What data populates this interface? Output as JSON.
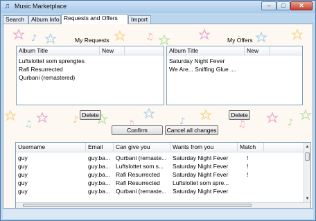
{
  "window": {
    "title": "Music Marketplace",
    "minimize_glyph": "–",
    "maximize_glyph": "□",
    "close_glyph": "✕",
    "icon": "music-note-icon"
  },
  "tabs": [
    {
      "label": "Search"
    },
    {
      "label": "Album Info"
    },
    {
      "label": "Requests and Offers"
    },
    {
      "label": "Import"
    }
  ],
  "my_requests": {
    "title": "My Requests",
    "columns": [
      "Album Title",
      "New"
    ],
    "rows": [
      "Luftslottet som sprengtes",
      "Rafi Resurrected",
      "Qurbani (remastered)"
    ],
    "delete_label": "Delete"
  },
  "my_offers": {
    "title": "My Offers",
    "columns": [
      "Album Title",
      "New"
    ],
    "rows": [
      "Saturday Night Fever",
      "We Are... Sniffing Glue ...."
    ],
    "delete_label": "Delete"
  },
  "actions": {
    "confirm_label": "Confirm",
    "cancel_label": "Cancel all changes"
  },
  "matches": {
    "columns": [
      "Username",
      "Email",
      "Can give you",
      "Wants from you",
      "Match"
    ],
    "rows": [
      [
        "guy",
        "guy.ba...",
        "Qurbani (remaste...",
        "Saturday Night Fever",
        "!"
      ],
      [
        "guy",
        "guy.ba...",
        "Luftslottet som s...",
        "Saturday Night Fever",
        "!"
      ],
      [
        "guy",
        "guy.ba...",
        "Rafi Resurrected",
        "Saturday Night Fever",
        "!"
      ],
      [
        "guy",
        "guy.ba...",
        "Rafi Resurrected",
        "Luftslottet som spre...",
        ""
      ],
      [
        "guy",
        "guy.ba...",
        "Qurbani (remaste...",
        "Saturday Night Fever",
        ""
      ]
    ]
  },
  "colors": {
    "accent": "#4a79a8",
    "selected_tab": "#ffffff",
    "background_pattern": "pastel-stars-and-music-notes"
  }
}
